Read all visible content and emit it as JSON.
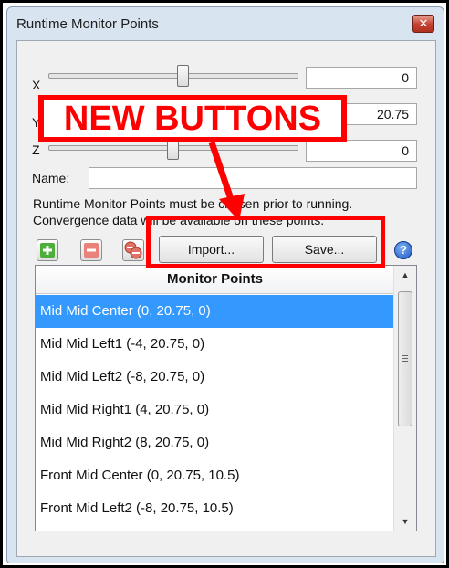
{
  "window": {
    "title": "Runtime Monitor Points",
    "close_symbol": "✕"
  },
  "fields": {
    "x_label": "X",
    "x_value": "0",
    "y_label": "Y",
    "y_value": "20.75",
    "z_label": "Z",
    "z_value": "0",
    "name_label": "Name:",
    "name_value": ""
  },
  "note": {
    "line1": "Runtime Monitor Points must be chosen prior to running.",
    "line2": "Convergence data will be available on these points."
  },
  "toolbar": {
    "add_symbol": "+",
    "remove_symbol": "−",
    "import_label": "Import...",
    "save_label": "Save...",
    "help_symbol": "?"
  },
  "list": {
    "header": "Monitor Points",
    "items": [
      "Mid Mid Center (0, 20.75, 0)",
      "Mid Mid Left1 (-4, 20.75, 0)",
      "Mid Mid Left2 (-8, 20.75, 0)",
      "Mid Mid Right1 (4, 20.75, 0)",
      "Mid Mid Right2 (8, 20.75, 0)",
      "Front Mid Center (0, 20.75, 10.5)",
      "Front Mid Left2 (-8, 20.75, 10.5)"
    ],
    "selected_index": 0
  },
  "annotation": {
    "label": "NEW BUTTONS",
    "color": "#ff0000"
  },
  "colors": {
    "selection": "#3399ff",
    "annotation": "#ff0000"
  }
}
